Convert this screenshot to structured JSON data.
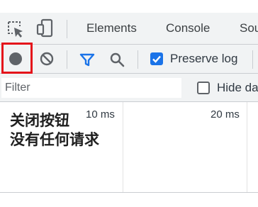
{
  "tabs": [
    {
      "label": "Elements"
    },
    {
      "label": "Console"
    },
    {
      "label": "Sou"
    }
  ],
  "toolbar": {
    "preserve_log_label": "Preserve log",
    "preserve_log_checked": true
  },
  "filter": {
    "placeholder": "Filter",
    "hide_data_label": "Hide da",
    "hide_data_checked": false
  },
  "timeline": {
    "ticks": [
      "10 ms",
      "20 ms"
    ],
    "empty_message": "关闭按钮\n没有任何请求"
  },
  "colors": {
    "record_dot": "#5f6368",
    "accent_blue": "#1a73e8",
    "highlight_red": "#e4141b",
    "toolbar_bg": "#f1f3f4"
  }
}
